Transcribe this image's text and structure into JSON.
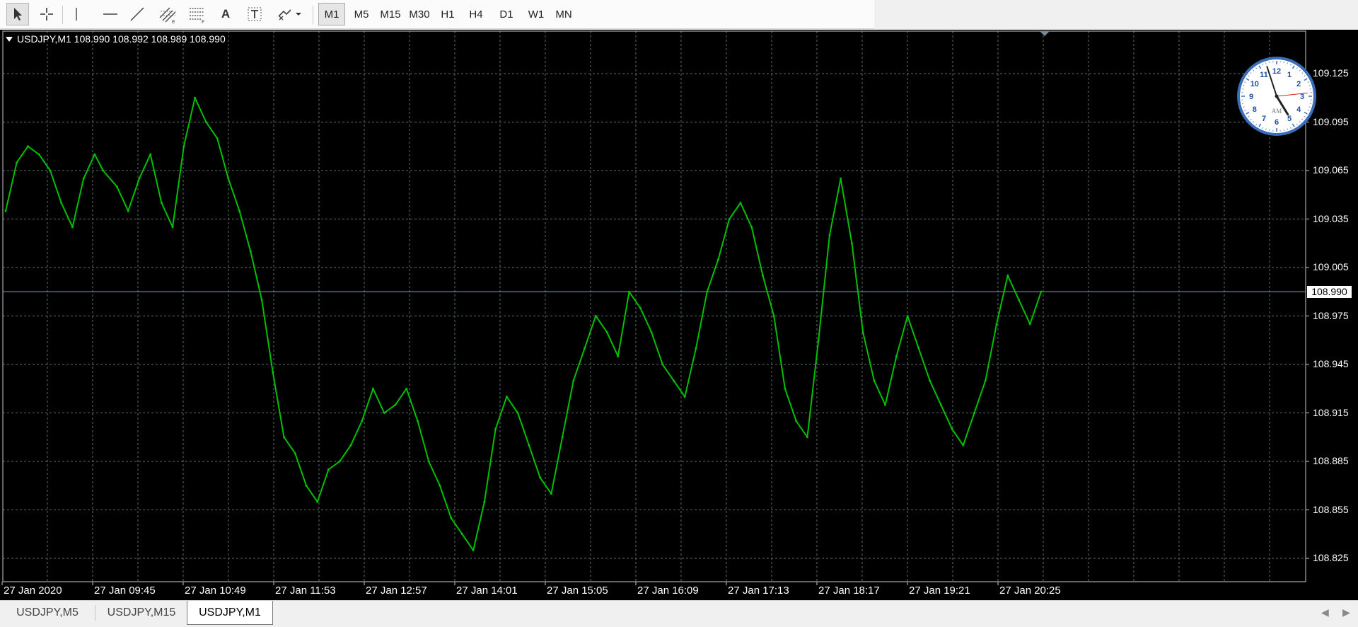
{
  "toolbar": {
    "tools": [
      {
        "name": "cursor-icon",
        "active": true
      },
      {
        "name": "crosshair-icon",
        "active": false
      },
      {
        "name": "vertical-line-icon",
        "active": false
      },
      {
        "name": "horizontal-line-icon",
        "active": false
      },
      {
        "name": "trendline-icon",
        "active": false
      },
      {
        "name": "equidistant-channel-icon",
        "active": false
      },
      {
        "name": "fibonacci-icon",
        "active": false
      },
      {
        "name": "text-icon",
        "active": false
      },
      {
        "name": "text-label-icon",
        "active": false
      },
      {
        "name": "arrows-icon",
        "active": false
      }
    ],
    "text_tool_label": "A",
    "timeframes": [
      "M1",
      "M5",
      "M15",
      "M30",
      "H1",
      "H4",
      "D1",
      "W1",
      "MN"
    ],
    "active_timeframe": "M1"
  },
  "chart": {
    "symbol_line": "USDJPY,M1  108.990 108.992 108.989 108.990",
    "background": "#000000",
    "line_color": "#00c000",
    "grid_color": "#5c6c6c",
    "current_price_label": "108.990",
    "clock": {
      "numbers": [
        "12",
        "1",
        "2",
        "3",
        "4",
        "5",
        "6",
        "7",
        "8",
        "9",
        "10",
        "11"
      ],
      "ampm": "AM",
      "hour_hand": 4,
      "minute_hand": 57,
      "second_hand": 14
    }
  },
  "chart_data": {
    "type": "line",
    "title": "",
    "xlabel": "",
    "ylabel": "",
    "ylim": [
      108.81,
      109.15
    ],
    "grid": true,
    "y_ticks": [
      "109.125",
      "109.095",
      "109.065",
      "109.035",
      "109.005",
      "108.975",
      "108.945",
      "108.915",
      "108.885",
      "108.855",
      "108.825"
    ],
    "x_ticks": [
      "27 Jan 2020",
      "27 Jan 09:45",
      "27 Jan 10:49",
      "27 Jan 11:53",
      "27 Jan 12:57",
      "27 Jan 14:01",
      "27 Jan 15:05",
      "27 Jan 16:09",
      "27 Jan 17:13",
      "27 Jan 18:17",
      "27 Jan 19:21",
      "27 Jan 20:25"
    ],
    "current_price": 108.99,
    "series": [
      {
        "points_x_minutes_from_0841": [
          0,
          8,
          16,
          24,
          32,
          40,
          48,
          56,
          64,
          70,
          80,
          88,
          96,
          104,
          112,
          120,
          128,
          136,
          144,
          152,
          160,
          168,
          176,
          184,
          192,
          200,
          208,
          216,
          224,
          232,
          240,
          248,
          256,
          264,
          272,
          280,
          288,
          296,
          304,
          312,
          320,
          328,
          336,
          344,
          352,
          360,
          368,
          376,
          384,
          392,
          400,
          408,
          416,
          424,
          432,
          440,
          448,
          456,
          464,
          472,
          480,
          488,
          496,
          504,
          512,
          520,
          528,
          536,
          544,
          552,
          560,
          568,
          576,
          584,
          592,
          600,
          608,
          616,
          624,
          632,
          640,
          648,
          656,
          664,
          672,
          680,
          688,
          696,
          704,
          712,
          720,
          728,
          736,
          744
        ],
        "values": [
          109.04,
          109.07,
          109.08,
          109.075,
          109.065,
          109.045,
          109.03,
          109.06,
          109.075,
          109.065,
          109.055,
          109.04,
          109.06,
          109.075,
          109.045,
          109.03,
          109.08,
          109.11,
          109.095,
          109.085,
          109.06,
          109.04,
          109.015,
          108.985,
          108.94,
          108.9,
          108.89,
          108.87,
          108.86,
          108.88,
          108.885,
          108.895,
          108.91,
          108.93,
          108.915,
          108.92,
          108.93,
          108.91,
          108.885,
          108.87,
          108.85,
          108.84,
          108.83,
          108.86,
          108.905,
          108.925,
          108.915,
          108.895,
          108.875,
          108.865,
          108.9,
          108.935,
          108.955,
          108.975,
          108.965,
          108.95,
          108.99,
          108.98,
          108.965,
          108.945,
          108.935,
          108.925,
          108.955,
          108.99,
          109.01,
          109.035,
          109.045,
          109.03,
          109.0,
          108.975,
          108.93,
          108.91,
          108.9,
          108.96,
          109.025,
          109.06,
          109.02,
          108.965,
          108.935,
          108.92,
          108.95,
          108.975,
          108.955,
          108.935,
          108.92,
          108.905,
          108.895,
          108.915,
          108.935,
          108.97,
          109.0,
          108.985,
          108.97,
          108.99
        ]
      }
    ]
  },
  "tabs": [
    {
      "label": "USDJPY,M5",
      "active": false
    },
    {
      "label": "USDJPY,M15",
      "active": false
    },
    {
      "label": "USDJPY,M1",
      "active": true
    }
  ]
}
